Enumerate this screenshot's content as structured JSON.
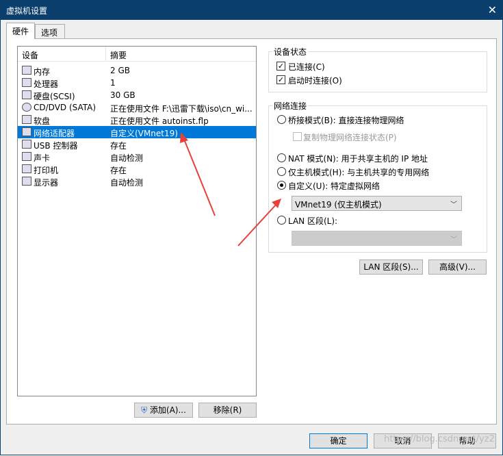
{
  "window": {
    "title": "虚拟机设置",
    "close_label": "✕"
  },
  "tabs": [
    {
      "label": "硬件"
    },
    {
      "label": "选项"
    }
  ],
  "device_list": {
    "col_device": "设备",
    "col_summary": "摘要",
    "rows": [
      {
        "device": "内存",
        "summary": "2 GB",
        "icon": "memory-icon"
      },
      {
        "device": "处理器",
        "summary": "1",
        "icon": "processor-icon"
      },
      {
        "device": "硬盘(SCSI)",
        "summary": "30 GB",
        "icon": "harddisk-icon"
      },
      {
        "device": "CD/DVD (SATA)",
        "summary": "正在使用文件 F:\\迅雷下载\\iso\\cn_wi...",
        "icon": "cdrom-icon"
      },
      {
        "device": "软盘",
        "summary": "正在使用文件 autoinst.flp",
        "icon": "floppy-icon"
      },
      {
        "device": "网络适配器",
        "summary": "自定义(VMnet19)",
        "icon": "network-icon"
      },
      {
        "device": "USB 控制器",
        "summary": "存在",
        "icon": "usb-icon"
      },
      {
        "device": "声卡",
        "summary": "自动检测",
        "icon": "sound-icon"
      },
      {
        "device": "打印机",
        "summary": "存在",
        "icon": "printer-icon"
      },
      {
        "device": "显示器",
        "summary": "自动检测",
        "icon": "display-icon"
      }
    ]
  },
  "add_button": "添加(A)...",
  "remove_button": "移除(R)",
  "device_status": {
    "title": "设备状态",
    "connected": "已连接(C)",
    "connect_at_power_on": "启动时连接(O)"
  },
  "network": {
    "title": "网络连接",
    "bridged": "桥接模式(B): 直接连接物理网络",
    "replicate": "复制物理网络连接状态(P)",
    "nat": "NAT 模式(N): 用于共享主机的 IP 地址",
    "host_only": "仅主机模式(H): 与主机共享的专用网络",
    "custom": "自定义(U): 特定虚拟网络",
    "custom_select": "VMnet19 (仅主机模式)",
    "lan_segment": "LAN 区段(L):",
    "lan_select": ""
  },
  "lan_segments_button": "LAN 区段(S)...",
  "advanced_button": "高级(V)...",
  "footer": {
    "ok": "确定",
    "cancel": "取消",
    "help": "帮助"
  },
  "watermark": "https://blog.csdn.net/yz2",
  "colors": {
    "selection": "#0078d7",
    "titlebar": "#0b3f6e",
    "annotation_arrow": "#e8403a"
  }
}
